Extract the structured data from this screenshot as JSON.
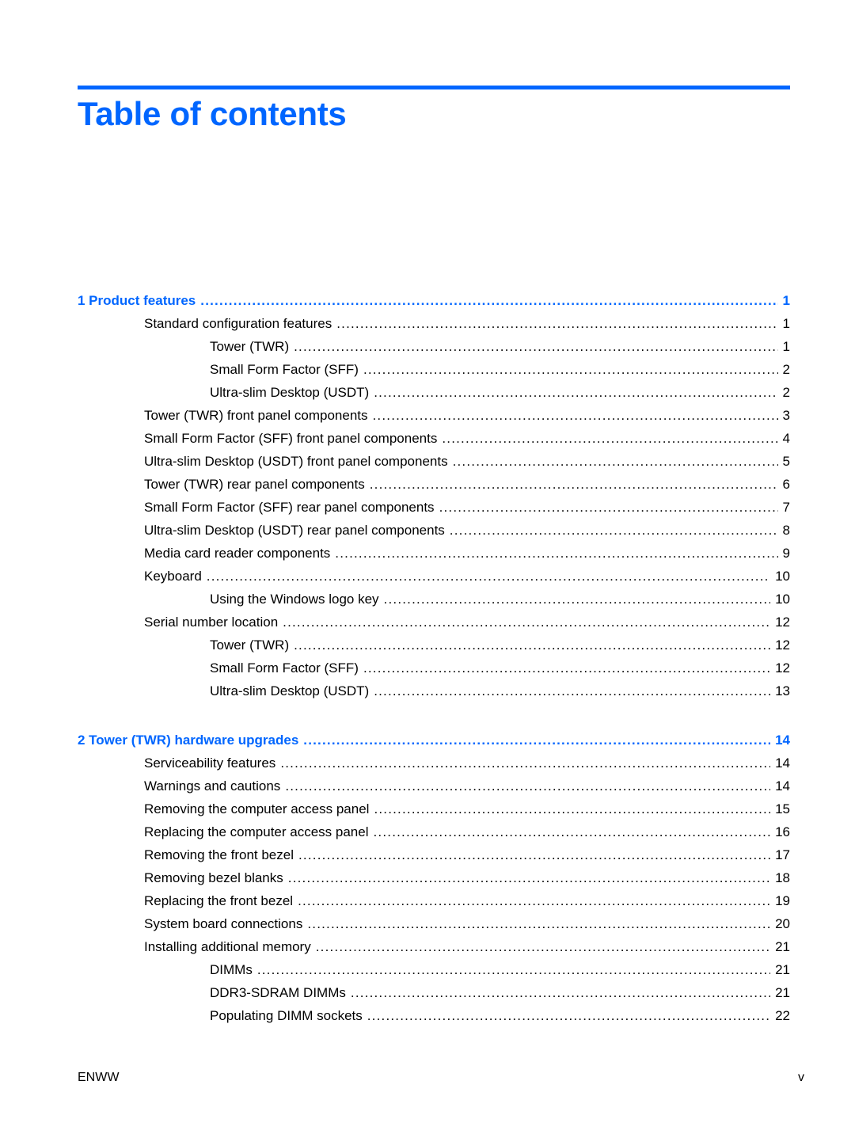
{
  "title": "Table of contents",
  "accent_color": "#0066ff",
  "chapters": [
    {
      "label": "1  Product features",
      "page": "1",
      "entries": [
        {
          "label": "Standard configuration features",
          "page": "1",
          "level": 1
        },
        {
          "label": "Tower (TWR)",
          "page": "1",
          "level": 2
        },
        {
          "label": "Small Form Factor (SFF)",
          "page": "2",
          "level": 2
        },
        {
          "label": "Ultra-slim Desktop (USDT)",
          "page": "2",
          "level": 2
        },
        {
          "label": "Tower (TWR) front panel components",
          "page": "3",
          "level": 1
        },
        {
          "label": "Small Form Factor (SFF) front panel components",
          "page": "4",
          "level": 1
        },
        {
          "label": "Ultra-slim Desktop (USDT) front panel components",
          "page": "5",
          "level": 1
        },
        {
          "label": "Tower (TWR) rear panel components",
          "page": "6",
          "level": 1
        },
        {
          "label": "Small Form Factor (SFF) rear panel components",
          "page": "7",
          "level": 1
        },
        {
          "label": "Ultra-slim Desktop (USDT) rear panel components",
          "page": "8",
          "level": 1
        },
        {
          "label": "Media card reader components",
          "page": "9",
          "level": 1
        },
        {
          "label": "Keyboard",
          "page": "10",
          "level": 1
        },
        {
          "label": "Using the Windows logo key",
          "page": "10",
          "level": 2
        },
        {
          "label": "Serial number location",
          "page": "12",
          "level": 1
        },
        {
          "label": "Tower (TWR)",
          "page": "12",
          "level": 2
        },
        {
          "label": "Small Form Factor (SFF)",
          "page": "12",
          "level": 2
        },
        {
          "label": "Ultra-slim Desktop (USDT)",
          "page": "13",
          "level": 2
        }
      ]
    },
    {
      "label": "2  Tower (TWR) hardware upgrades",
      "page": "14",
      "entries": [
        {
          "label": "Serviceability features",
          "page": "14",
          "level": 1
        },
        {
          "label": "Warnings and cautions",
          "page": "14",
          "level": 1
        },
        {
          "label": "Removing the computer access panel",
          "page": "15",
          "level": 1
        },
        {
          "label": "Replacing the computer access panel",
          "page": "16",
          "level": 1
        },
        {
          "label": "Removing the front bezel",
          "page": "17",
          "level": 1
        },
        {
          "label": "Removing bezel blanks",
          "page": "18",
          "level": 1
        },
        {
          "label": "Replacing the front bezel",
          "page": "19",
          "level": 1
        },
        {
          "label": "System board connections",
          "page": "20",
          "level": 1
        },
        {
          "label": "Installing additional memory",
          "page": "21",
          "level": 1
        },
        {
          "label": "DIMMs",
          "page": "21",
          "level": 2
        },
        {
          "label": "DDR3-SDRAM DIMMs",
          "page": "21",
          "level": 2
        },
        {
          "label": "Populating DIMM sockets",
          "page": "22",
          "level": 2
        }
      ]
    }
  ],
  "footer": {
    "left": "ENWW",
    "right": "v"
  }
}
